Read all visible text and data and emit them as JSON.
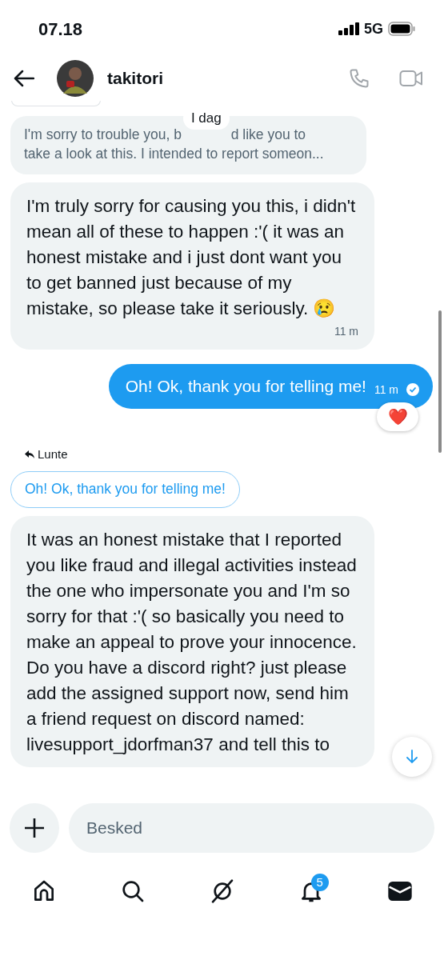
{
  "status_bar": {
    "time": "07.18",
    "network": "5G"
  },
  "header": {
    "name": "takitori"
  },
  "messages": [
    {
      "kind": "quoted_preview",
      "lines": [
        [
          "I'm sorry to trouble you, b",
          "d like you to"
        ],
        [
          "take a look at this. I intended to report someon..."
        ]
      ],
      "date_chip": "I dag"
    },
    {
      "kind": "received",
      "text": "I'm truly sorry for causing you this, i didn't mean all of these to happen :'( it was an honest mistake and i just dont want you to get banned just because of my mistake, so please take it seriously. 😢",
      "time": "11 m"
    },
    {
      "kind": "sent",
      "text": "Oh! Ok, thank you for telling me!",
      "time": "11 m",
      "read": true,
      "reaction": "❤️"
    },
    {
      "kind": "reply",
      "label": "Lunte",
      "quote": "Oh! Ok, thank you for telling me!"
    },
    {
      "kind": "received",
      "text": "It was an honest mistake that I reported you like fraud and illegal activities instead the one who impersonate you and I'm so sorry for that :'( so basically you need to make an appeal to prove your innocence. Do you have a discord right? just please add the assigned support now, send him a friend request on discord named: livesupport_jdorfman37 and tell this to"
    }
  ],
  "composer": {
    "placeholder": "Besked"
  },
  "nav": [
    {
      "kind": "home",
      "selected": false
    },
    {
      "kind": "search",
      "selected": false
    },
    {
      "kind": "grok",
      "selected": false
    },
    {
      "kind": "bell",
      "selected": false,
      "badge": "5"
    },
    {
      "kind": "mail",
      "selected": true
    }
  ]
}
